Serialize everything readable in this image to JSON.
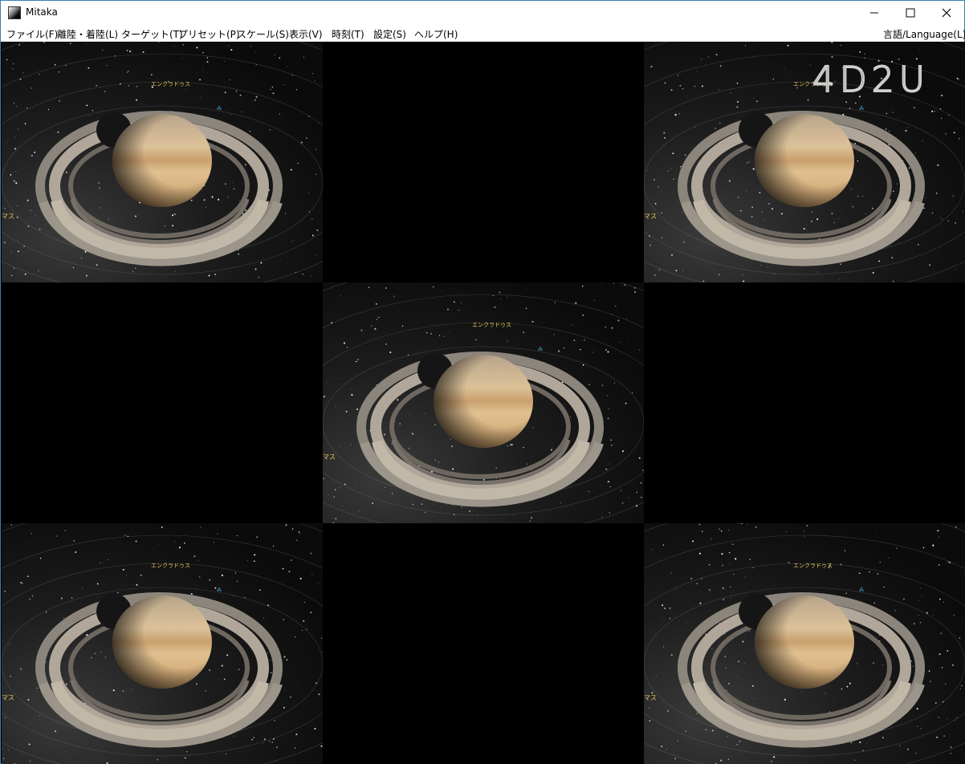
{
  "window": {
    "title": "Mitaka",
    "controls": {
      "minimize": "—",
      "maximize": "☐",
      "close": "✕"
    }
  },
  "menu": {
    "items": [
      {
        "label": "ファイル(F)"
      },
      {
        "label": "離陸・着陸(L)"
      },
      {
        "label": "ターゲット(T)"
      },
      {
        "label": "プリセット(P)"
      },
      {
        "label": "スケール(S)"
      },
      {
        "label": "表示(V)"
      },
      {
        "label": "時刻(T)"
      },
      {
        "label": "設定(S)"
      },
      {
        "label": "ヘルプ(H)"
      }
    ],
    "language": "言語/Language(L)"
  },
  "scene": {
    "moon_label": "エンクラドゥス",
    "edge_label": "マス",
    "logo": "4D2U",
    "colors": {
      "label": "#e6c85a",
      "moon_marker": "#4fc3f7",
      "saturn": "#d8b88a"
    }
  }
}
